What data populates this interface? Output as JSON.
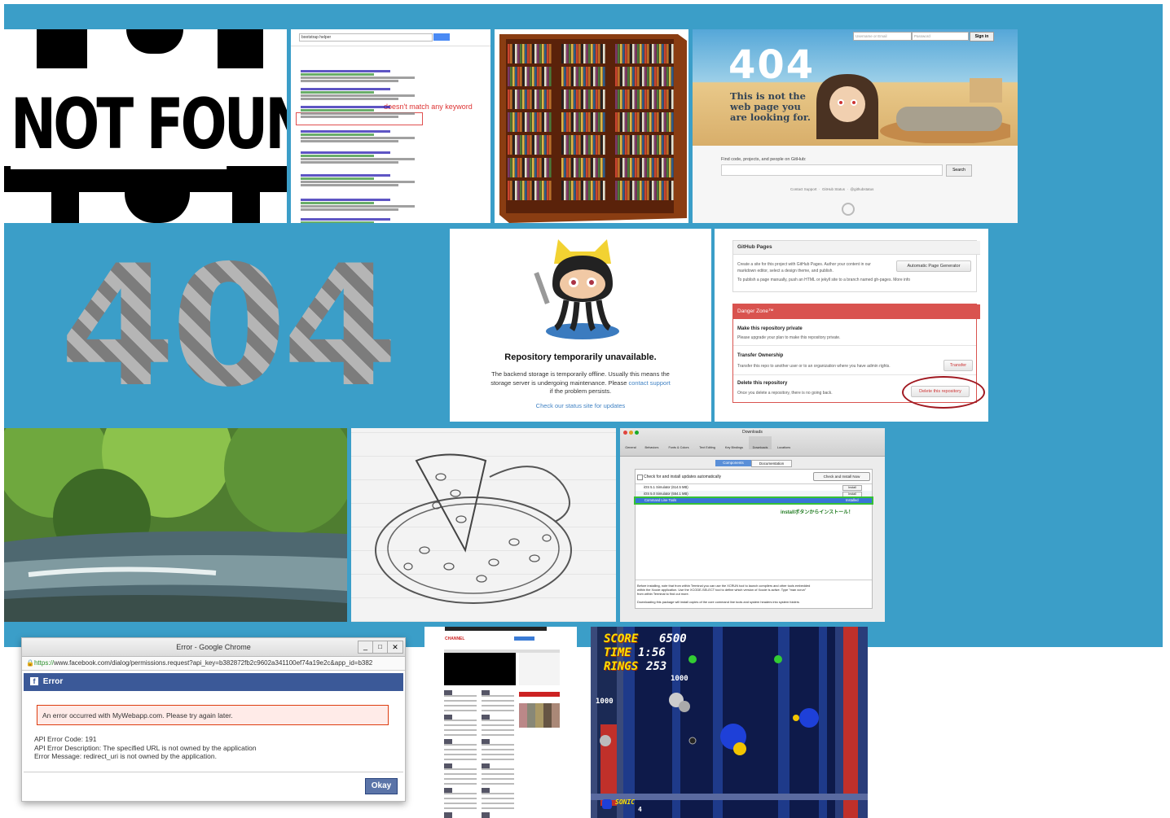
{
  "tile1": {
    "text": "NOT FOUND"
  },
  "tile2": {
    "query": "bootstrap helper",
    "annotation": "doesn't match any keyword"
  },
  "tile4": {
    "placeholder_user": "Username or Email",
    "placeholder_pass": "Password",
    "sign_in": "Sign in",
    "big": "404",
    "msg1": "This is not the",
    "msg2": "web page you",
    "msg3": "are looking for.",
    "find_label": "Find code, projects, and people on GitHub:",
    "search_btn": "Search",
    "link1": "Contact Support",
    "link2": "GitHub Status",
    "link3": "@githubstatus"
  },
  "tile5": {
    "text": "404"
  },
  "tile6": {
    "title": "Repository temporarily unavailable.",
    "body1": "The backend storage is temporarily offline. Usually this means the",
    "body2a": "storage server is undergoing maintenance. Please ",
    "body2b": "contact support",
    "body3": "if the problem persists.",
    "link": "Check our status site for updates"
  },
  "tile7": {
    "pages_title": "GitHub Pages",
    "pages_line1": "Create a site for this project with GitHub Pages. Author your content in our",
    "pages_line2": "markdown editor, select a design theme, and publish.",
    "pages_line3": "To publish a page manually, push an HTML or jekyll site to a branch named gh-pages. More info",
    "auto_btn": "Automatic Page Generator",
    "danger_title": "Danger Zone™",
    "private_title": "Make this repository private",
    "private_desc": "Please upgrade your plan to make this repository private.",
    "transfer_title": "Transfer Ownership",
    "transfer_desc": "Transfer this repo to another user or to an organization where you have admin rights.",
    "transfer_btn": "Transfer",
    "delete_title": "Delete this repository",
    "delete_desc": "Once you delete a repository, there is no going back.",
    "delete_btn": "Delete this repository"
  },
  "tile10": {
    "window_title": "Downloads",
    "toolbar": [
      "General",
      "Behaviors",
      "Fonts & Colors",
      "Text Editing",
      "Key Bindings",
      "Downloads",
      "Locations"
    ],
    "tab1": "Components",
    "tab2": "Documentation",
    "check_label": "Check for and install updates automatically",
    "check_btn": "Check and Install Now",
    "rows": [
      {
        "name": "iOS 5.1 Simulator (614.5 MB)",
        "action": "Install"
      },
      {
        "name": "iOS 5.0 Simulator (554.1 MB)",
        "action": "Install"
      },
      {
        "name": "Command Line Tools",
        "action": "Installed"
      }
    ],
    "annotation": "installボタンからインストール！",
    "desc1": "Before installing, note that from within Terminal you can use the XCRUN tool to launch compilers and other tools embedded",
    "desc2": "within the Xcode application. Use the XCODE-SELECT tool to define which version of Xcode is active. Type \"man xcrun\"",
    "desc3": "from within Terminal to find out more.",
    "desc4": "Downloading this package will install copies of the core command line tools and system headers into system folders"
  },
  "tile11": {
    "window_title": "Error - Google Chrome",
    "url_green": "https://",
    "url_rest": "www.facebook.com/dialog/permissions.request?api_key=b382872fb2c9602a341100ef74a19e2c&app_id=b382",
    "header": "Error",
    "error_box": "An error occurred with MyWebapp.com. Please try again later.",
    "line1": "API Error Code: 191",
    "line2": "API Error Description: The specified URL is not owned by the application",
    "line3": "Error Message: redirect_uri is not owned by the application.",
    "okay": "Okay"
  },
  "tile12": {
    "logo": "CHANNEL"
  },
  "tile13": {
    "score_label": "SCORE",
    "score_value": "6500",
    "time_label": "TIME",
    "time_value": "1:56",
    "rings_label": "RINGS",
    "rings_value": "253",
    "points1": "1000",
    "points2": "1000",
    "lives_label": "SONIC",
    "lives_value": "4"
  }
}
